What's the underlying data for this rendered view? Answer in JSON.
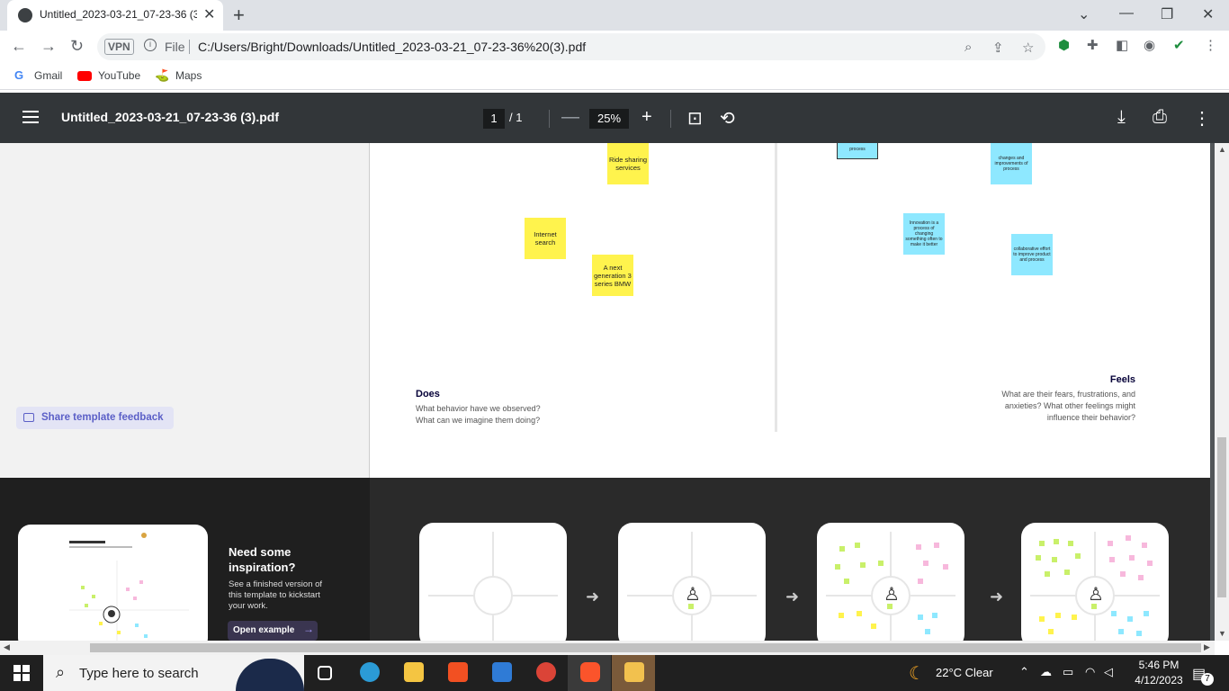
{
  "browser": {
    "tab_title": "Untitled_2023-03-21_07-23-36 (3",
    "url_scheme": "File",
    "url": "C:/Users/Bright/Downloads/Untitled_2023-03-21_07-23-36%20(3).pdf",
    "vpn_label": "VPN",
    "bookmarks": [
      "Gmail",
      "YouTube",
      "Maps"
    ]
  },
  "pdf": {
    "filename": "Untitled_2023-03-21_07-23-36 (3).pdf",
    "page_current": "1",
    "page_total": "/ 1",
    "zoom": "25%"
  },
  "left_panel": {
    "feedback_label": "Share template feedback"
  },
  "board": {
    "yellow_stickies": [
      "Ride sharing services",
      "Internet search",
      "A next generation 3 series BMW"
    ],
    "blue_stickies": [
      "process",
      "changes and improvements of process",
      "Innovation is a process of changing something often to make it better",
      "collaborative effort to improve product and process"
    ],
    "does_title": "Does",
    "does_desc_1": "What behavior have we observed?",
    "does_desc_2": "What can we imagine them doing?",
    "feels_title": "Feels",
    "feels_desc_1": "What are their fears, frustrations, and",
    "feels_desc_2": "anxieties? What other feelings might",
    "feels_desc_3": "influence their behavior?"
  },
  "inspiration": {
    "title": "Need some inspiration?",
    "desc": "See a finished version of this template to kickstart your work.",
    "button": "Open example"
  },
  "taskbar": {
    "search_placeholder": "Type here to search",
    "weather": "22°C  Clear",
    "time": "5:46 PM",
    "date": "4/12/2023",
    "notifications": "7"
  },
  "colors": {
    "sticky_yellow": "#fff34d",
    "sticky_blue": "#8ee8ff",
    "sticky_pink": "#f7b8dc",
    "sticky_green": "#c9f06a",
    "accent_purple": "#5b5fc7"
  }
}
